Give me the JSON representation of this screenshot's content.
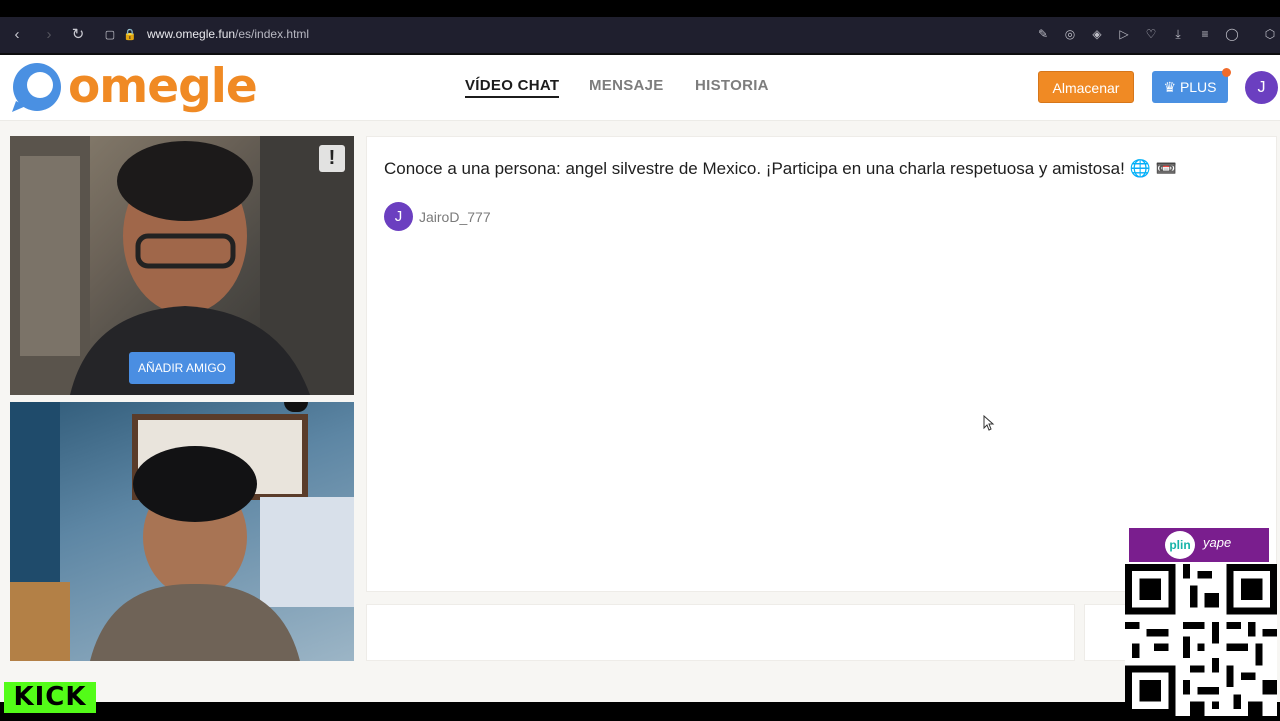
{
  "browser": {
    "url_domain": "www.omegle.fun",
    "url_path": "/es/index.html"
  },
  "header": {
    "logo_text": "omegle",
    "nav": [
      "VÍDEO CHAT",
      "MENSAJE",
      "HISTORIA"
    ],
    "store_label": "Almacenar",
    "plus_label": "PLUS",
    "avatar_initial": "J"
  },
  "video": {
    "add_friend_label": "AÑADIR AMIGO",
    "report_icon": "!"
  },
  "chat": {
    "message": "Conoce a una persona: angel silvestre de Mexico. ¡Participa en una charla respetuosa y amistosa! 🌐 📼",
    "user_initial": "J",
    "username": "JairoD_777"
  },
  "overlays": {
    "kick_label": "KICK",
    "plin_label": "plin",
    "yape_label": "yape"
  }
}
